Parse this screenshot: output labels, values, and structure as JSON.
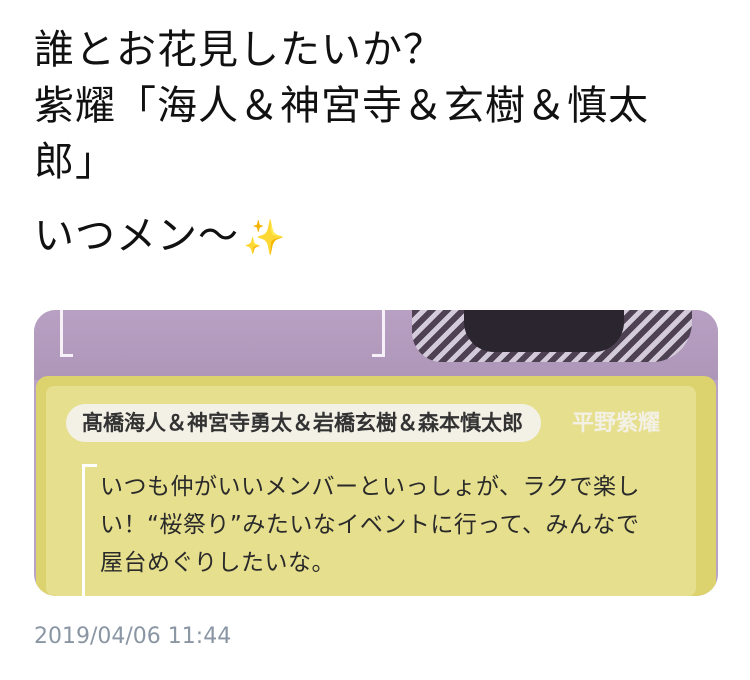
{
  "tweet": {
    "lines": [
      "誰とお花見したいか？",
      "紫耀「海人＆神宮寺＆玄樹＆慎太",
      "郎」",
      "いつメン〜"
    ],
    "emoji": "✨",
    "emoji_name": "sparkles-icon"
  },
  "media": {
    "name_tag": "髙橋海人＆神宮寺勇太＆岩橋玄樹＆森本慎太郎",
    "author": "平野紫耀",
    "quote_lines": [
      "いつも仲がいいメンバーといっしょが、ラクで楽し",
      "い！“桜祭り”みたいなイベントに行って、みんなで",
      "屋台めぐりしたいな。"
    ],
    "colors": {
      "card": "#dcd36f",
      "photo_bg": "#b9a3c4"
    }
  },
  "timestamp": "2019/04/06 11:44"
}
